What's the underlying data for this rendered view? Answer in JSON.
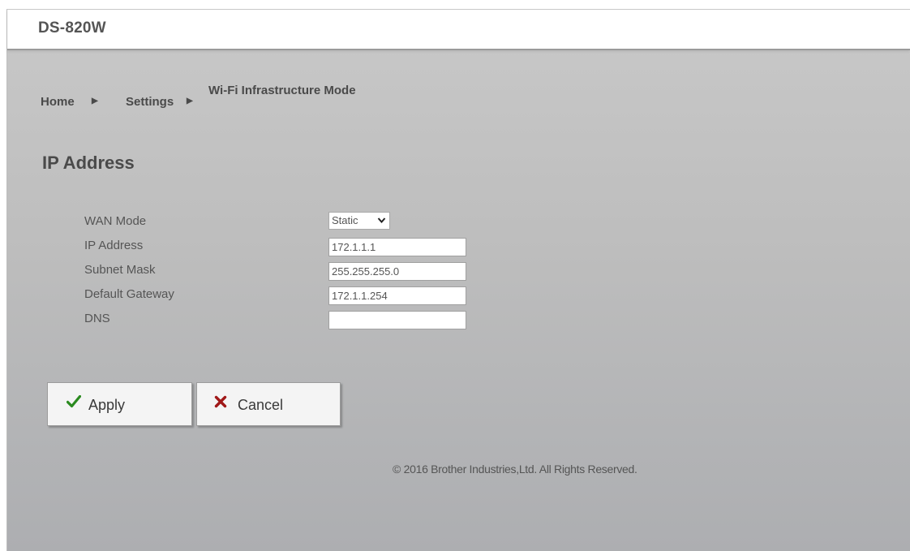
{
  "header": {
    "model": "DS-820W"
  },
  "breadcrumb": {
    "home": "Home",
    "separator": "▶",
    "settings": "Settings",
    "current": "Wi-Fi Infrastructure Mode"
  },
  "section": {
    "title": "IP Address"
  },
  "form": {
    "wan_mode": {
      "label": "WAN Mode",
      "value": "Static",
      "icon": "chevron-down-icon"
    },
    "ip_address": {
      "label": "IP Address",
      "value": "172.1.1.1"
    },
    "subnet_mask": {
      "label": "Subnet Mask",
      "value": "255.255.255.0"
    },
    "default_gateway": {
      "label": "Default Gateway",
      "value": "172.1.1.254"
    },
    "dns": {
      "label": "DNS",
      "value": ""
    }
  },
  "buttons": {
    "apply": {
      "label": "Apply",
      "icon": "checkmark-icon",
      "icon_color": "#2a8a1f"
    },
    "cancel": {
      "label": "Cancel",
      "icon": "x-mark-icon",
      "icon_color": "#a01818"
    }
  },
  "footer": {
    "copyright": "© 2016 Brother Industries,Ltd. All Rights Reserved."
  }
}
